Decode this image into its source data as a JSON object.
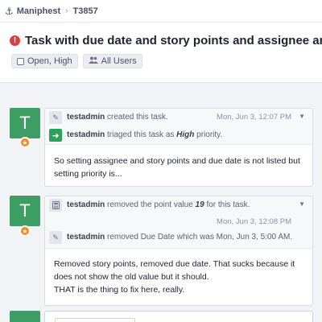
{
  "breadcrumb": {
    "app": "Maniphest",
    "task_id": "T3857"
  },
  "task": {
    "title": "Task with due date and story points and assignee and priority",
    "status_tag": "Open, High",
    "policy_tag": "All Users"
  },
  "events": [
    {
      "avatar_letter": "T",
      "rows": [
        {
          "icon": "pencil-icon",
          "user": "testadmin",
          "action": "created this task.",
          "time": "Mon, Jun 3, 12:07 PM"
        },
        {
          "icon": "arrow-right-icon",
          "user": "testadmin",
          "action_prefix": "triaged this task as",
          "priority": "High",
          "action_suffix": "priority."
        }
      ],
      "comment": "So setting assignee and story points and due date is not listed but setting priority is..."
    },
    {
      "avatar_letter": "T",
      "rows": [
        {
          "icon": "calculator-icon",
          "user": "testadmin",
          "action_prefix": "removed the point value",
          "value": "19",
          "action_suffix": "for this task.",
          "time": "Mon, Jun 3, 12:08 PM"
        },
        {
          "icon": "pencil-icon",
          "user": "testadmin",
          "action": "removed Due Date which was Mon, Jun 3, 5:00 AM."
        }
      ],
      "comment_lines": [
        "Removed story points, removed due date. That sucks because it does not show the old value but it should.",
        "THAT is the thing to fix here, really."
      ]
    }
  ],
  "colors": {
    "avatar": "#3c9e63",
    "alert": "#d9403a",
    "badge": "#f08a24",
    "triage": "#29a35a"
  }
}
